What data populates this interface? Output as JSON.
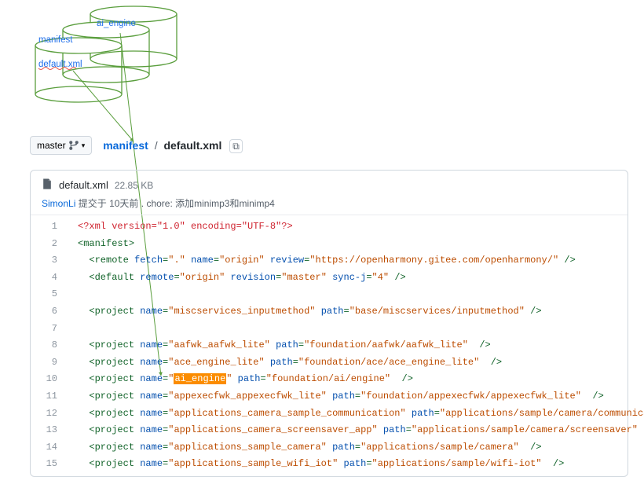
{
  "diagram": {
    "cylinder1": "ai_engine",
    "cylinder2": "manifest",
    "cylinder3": "default.xml"
  },
  "branch": {
    "label": "master"
  },
  "breadcrumb": {
    "root": "manifest",
    "current": "default.xml"
  },
  "file": {
    "name": "default.xml",
    "size": "22.85 KB",
    "author": "SimonLi",
    "commit_prefix": "提交于",
    "commit_time": "10天前",
    "commit_msg": "chore: 添加minimp3和minimp4"
  },
  "code": {
    "lines": [
      {
        "n": 1,
        "type": "decl",
        "text": "<?xml version=\"1.0\" encoding=\"UTF-8\"?>"
      },
      {
        "n": 2,
        "type": "open",
        "tag": "manifest"
      },
      {
        "n": 3,
        "type": "elem",
        "indent": 2,
        "tag": "remote",
        "attrs": [
          {
            "k": "fetch",
            "v": "."
          },
          {
            "k": "name",
            "v": "origin"
          },
          {
            "k": "review",
            "v": "https://openharmony.gitee.com/openharmony/"
          }
        ]
      },
      {
        "n": 4,
        "type": "elem",
        "indent": 2,
        "tag": "default",
        "attrs": [
          {
            "k": "remote",
            "v": "origin"
          },
          {
            "k": "revision",
            "v": "master"
          },
          {
            "k": "sync-j",
            "v": "4"
          }
        ]
      },
      {
        "n": 5,
        "type": "blank"
      },
      {
        "n": 6,
        "type": "elem",
        "indent": 2,
        "tag": "project",
        "attrs": [
          {
            "k": "name",
            "v": "miscservices_inputmethod"
          },
          {
            "k": "path",
            "v": "base/miscservices/inputmethod"
          }
        ]
      },
      {
        "n": 7,
        "type": "blank"
      },
      {
        "n": 8,
        "type": "elem",
        "indent": 2,
        "tag": "project",
        "attrs": [
          {
            "k": "name",
            "v": "aafwk_aafwk_lite"
          },
          {
            "k": "path",
            "v": "foundation/aafwk/aafwk_lite"
          }
        ],
        "trail": true
      },
      {
        "n": 9,
        "type": "elem",
        "indent": 2,
        "tag": "project",
        "attrs": [
          {
            "k": "name",
            "v": "ace_engine_lite"
          },
          {
            "k": "path",
            "v": "foundation/ace/ace_engine_lite"
          }
        ],
        "trail": true
      },
      {
        "n": 10,
        "type": "elem",
        "indent": 2,
        "tag": "project",
        "attrs": [
          {
            "k": "name",
            "v": "ai_engine",
            "hl": true
          },
          {
            "k": "path",
            "v": "foundation/ai/engine"
          }
        ],
        "trail": true
      },
      {
        "n": 11,
        "type": "elem",
        "indent": 2,
        "tag": "project",
        "attrs": [
          {
            "k": "name",
            "v": "appexecfwk_appexecfwk_lite"
          },
          {
            "k": "path",
            "v": "foundation/appexecfwk/appexecfwk_lite"
          }
        ],
        "trail": true
      },
      {
        "n": 12,
        "type": "elem",
        "indent": 2,
        "tag": "project",
        "attrs": [
          {
            "k": "name",
            "v": "applications_camera_sample_communication"
          },
          {
            "k": "path",
            "v": "applications/sample/camera/communication"
          }
        ],
        "trail": true
      },
      {
        "n": 13,
        "type": "elem",
        "indent": 2,
        "tag": "project",
        "attrs": [
          {
            "k": "name",
            "v": "applications_camera_screensaver_app"
          },
          {
            "k": "path",
            "v": "applications/sample/camera/screensaver"
          }
        ],
        "trail": true
      },
      {
        "n": 14,
        "type": "elem",
        "indent": 2,
        "tag": "project",
        "attrs": [
          {
            "k": "name",
            "v": "applications_sample_camera"
          },
          {
            "k": "path",
            "v": "applications/sample/camera"
          }
        ],
        "trail": true
      },
      {
        "n": 15,
        "type": "elem",
        "indent": 2,
        "tag": "project",
        "attrs": [
          {
            "k": "name",
            "v": "applications_sample_wifi_iot"
          },
          {
            "k": "path",
            "v": "applications/sample/wifi-iot"
          }
        ],
        "trail": true
      }
    ]
  }
}
